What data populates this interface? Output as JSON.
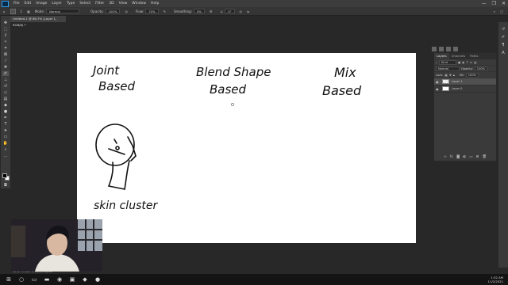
{
  "menubar": {
    "logo": "Ps",
    "items": [
      "File",
      "Edit",
      "Image",
      "Layer",
      "Type",
      "Select",
      "Filter",
      "3D",
      "View",
      "Window",
      "Help"
    ],
    "window_controls": [
      "—",
      "❐",
      "✕"
    ]
  },
  "options": {
    "brush_size": "1",
    "mode_label": "Mode:",
    "mode_value": "Normal",
    "opacity_label": "Opacity:",
    "opacity_value": "100%",
    "flow_label": "Flow:",
    "flow_value": "70%",
    "smoothing_label": "Smoothing:",
    "smoothing_value": "0%",
    "angle_value": "0°"
  },
  "document": {
    "tab_title": "Untitled-1 @ 66.7% (Layer 1, RGB/8) *"
  },
  "canvas": {
    "text_joint_line1": "Joint",
    "text_joint_line2": "Based",
    "text_blend_line1": "Blend Shape",
    "text_blend_line2": "Based",
    "text_mix_line1": "Mix",
    "text_mix_line2": "Based",
    "text_skin": "skin cluster"
  },
  "layers_panel": {
    "tabs": [
      "Layers",
      "Channels",
      "Paths"
    ],
    "filter_label": "Kind",
    "blend_mode": "Normal",
    "opacity_label": "Opacity:",
    "opacity_value": "100%",
    "lock_label": "Lock:",
    "fill_label": "Fill:",
    "fill_value": "100%",
    "layers": [
      {
        "name": "Layer 1",
        "active": true
      },
      {
        "name": "Layer 0",
        "active": false
      }
    ]
  },
  "statusbar": {
    "text": "66.67%   Doc: 2.64M/0 bytes"
  },
  "taskbar": {
    "time": "1:52 AM",
    "date": "11/2/2021"
  },
  "icons": {
    "eye": "visibility-eye-icon",
    "colors": {
      "canvas": "#ffffff",
      "workspace": "#282828",
      "panel": "#3a3a3a"
    }
  }
}
